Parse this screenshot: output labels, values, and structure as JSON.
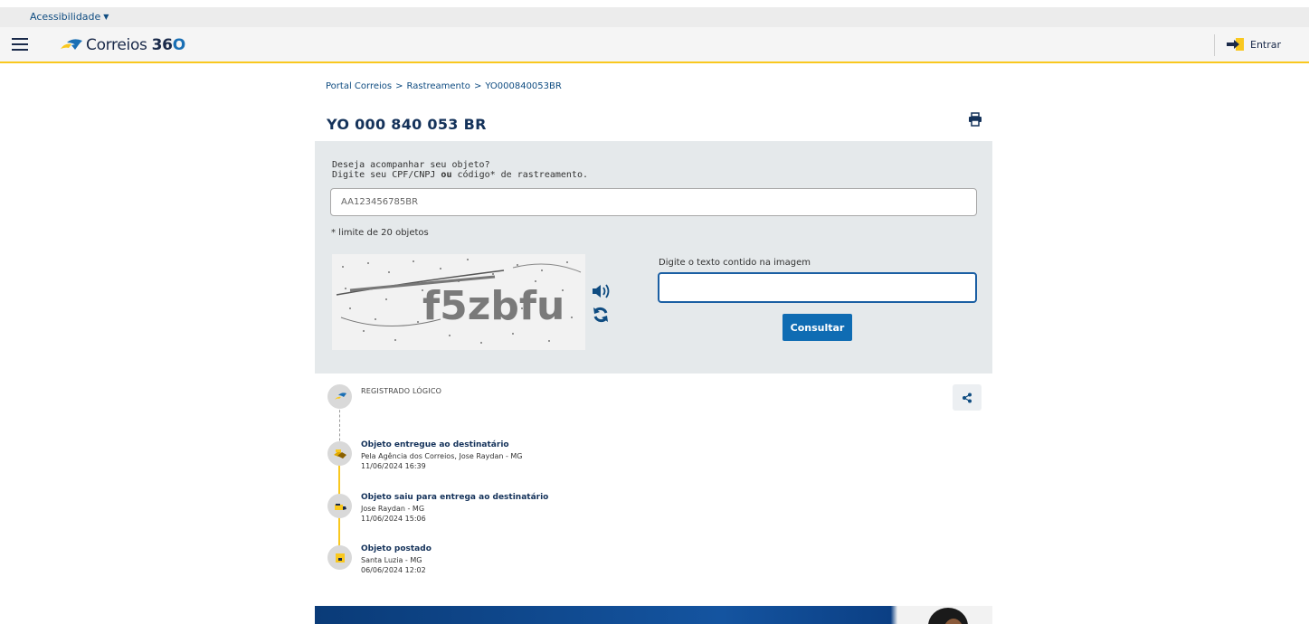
{
  "accessibility": {
    "label": "Acessibilidade"
  },
  "header": {
    "logo_text": "Correios",
    "logo_num_prefix": "36",
    "logo_num_suffix": "O",
    "login_label": "Entrar"
  },
  "breadcrumb": {
    "items": [
      "Portal Correios",
      "Rastreamento",
      "YO000840053BR"
    ],
    "separator": ">"
  },
  "page_title": "YO 000 840 053 BR",
  "search": {
    "prompt_line1": "Deseja acompanhar seu objeto?",
    "prompt_line2_pre": "Digite seu CPF/CNPJ ",
    "prompt_line2_bold": "ou",
    "prompt_line2_post": " código* de rastreamento.",
    "input_placeholder": "AA123456785BR",
    "limit_note": "* limite de 20 objetos",
    "captcha_text": "f5zbfu",
    "captcha_label": "Digite o texto contido na imagem",
    "submit_label": "Consultar"
  },
  "events": [
    {
      "title": "REGISTRADO LÓGICO",
      "location": "",
      "datetime": ""
    },
    {
      "title": "Objeto entregue ao destinatário",
      "location": "Pela Agência dos Correios, Jose Raydan - MG",
      "datetime": "11/06/2024 16:39"
    },
    {
      "title": "Objeto saiu para entrega ao destinatário",
      "location": "Jose Raydan - MG",
      "datetime": "11/06/2024 15:06"
    },
    {
      "title": "Objeto postado",
      "location": "Santa Luzia - MG",
      "datetime": "06/06/2024 12:02"
    }
  ],
  "colors": {
    "brand_blue": "#0f6cb3",
    "brand_yellow": "#f9c81f",
    "title_navy": "#14325a"
  }
}
